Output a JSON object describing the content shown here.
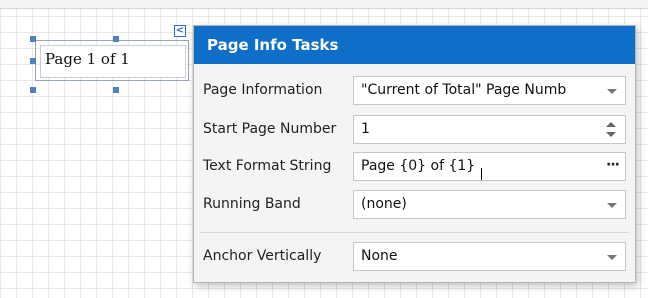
{
  "canvas": {
    "label_text": "Page 1 of 1",
    "collapse_glyph": "<"
  },
  "panel": {
    "title": "Page Info Tasks",
    "rows": [
      {
        "label": "Page Information",
        "value": "\"Current of Total\" Page Numb",
        "control": "dropdown"
      },
      {
        "label": "Start Page Number",
        "value": "1",
        "control": "spinner"
      },
      {
        "label": "Text Format String",
        "value": "Page {0} of {1}",
        "control": "ellipsis",
        "button_text": "···"
      },
      {
        "label": "Running Band",
        "value": "(none)",
        "control": "dropdown"
      },
      {
        "label": "Anchor Vertically",
        "value": "None",
        "control": "dropdown"
      }
    ]
  },
  "colors": {
    "header_bg": "#0f6ec7",
    "selection_handle": "#4f81bd",
    "panel_bg": "#f4f4f4"
  },
  "icons": [
    "collapse-arrow-icon",
    "chevron-down-icon",
    "spin-up-icon",
    "spin-down-icon",
    "ellipsis-icon"
  ]
}
